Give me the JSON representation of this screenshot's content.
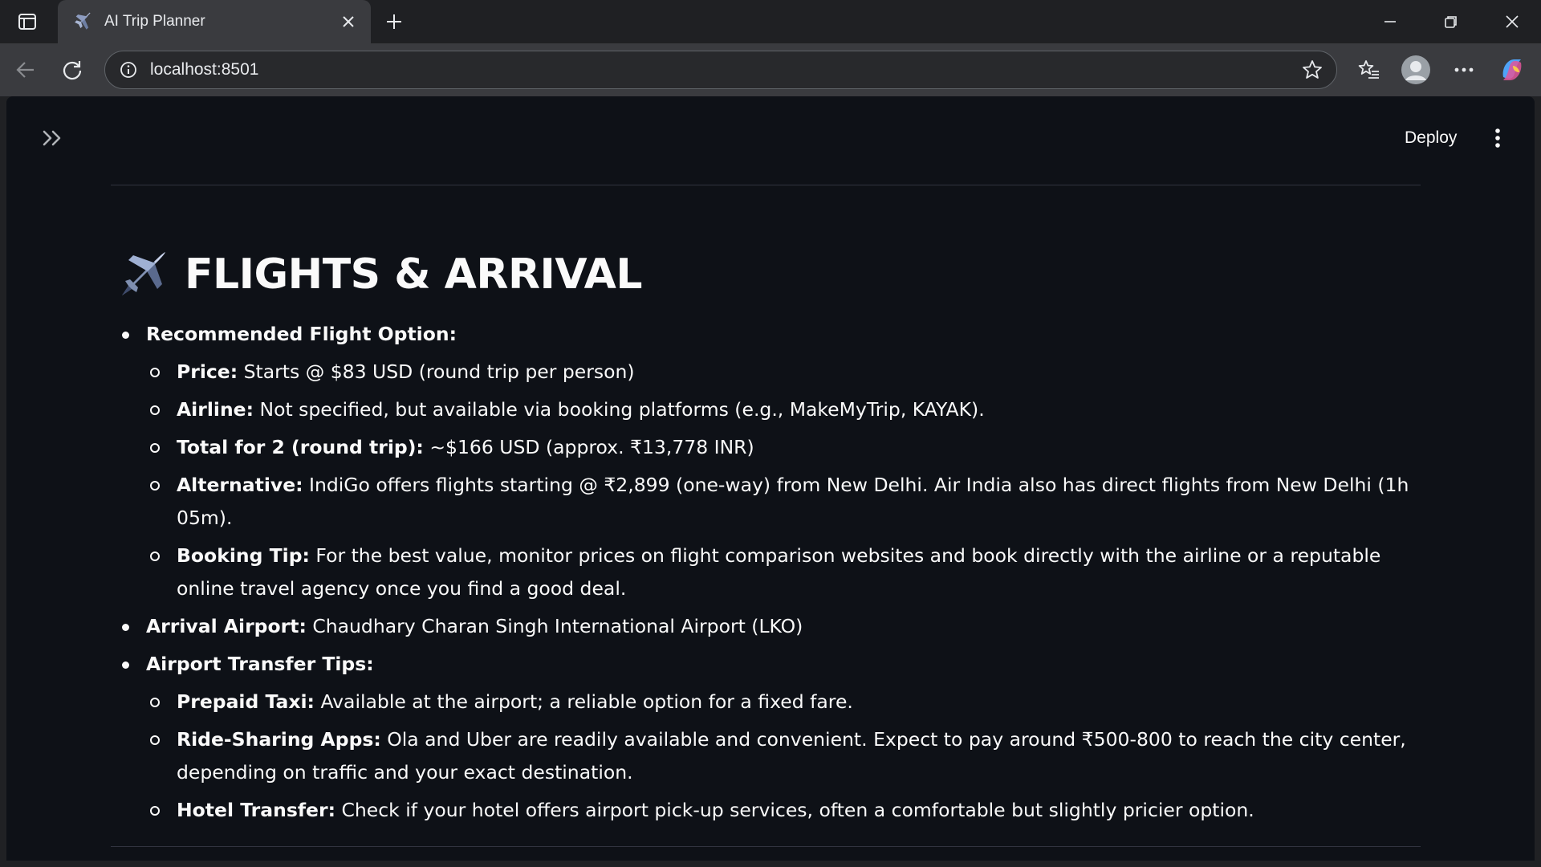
{
  "browser": {
    "tab_title": "AI Trip Planner",
    "url": "localhost:8501"
  },
  "app": {
    "deploy_label": "Deploy"
  },
  "section": {
    "heading": "FLIGHTS & ARRIVAL",
    "items": [
      {
        "label": "Recommended Flight Option:",
        "text": "",
        "sub": [
          {
            "label": "Price:",
            "text": " Starts @ $83 USD (round trip per person)"
          },
          {
            "label": "Airline:",
            "text": " Not specified, but available via booking platforms (e.g., MakeMyTrip, KAYAK)."
          },
          {
            "label": "Total for 2 (round trip):",
            "text": " ~$166 USD (approx. ₹13,778 INR)"
          },
          {
            "label": "Alternative:",
            "text": " IndiGo offers flights starting @ ₹2,899 (one-way) from New Delhi. Air India also has direct flights from New Delhi (1h 05m)."
          },
          {
            "label": "Booking Tip:",
            "text": " For the best value, monitor prices on flight comparison websites and book directly with the airline or a reputable online travel agency once you find a good deal."
          }
        ]
      },
      {
        "label": "Arrival Airport:",
        "text": " Chaudhary Charan Singh International Airport (LKO)",
        "sub": []
      },
      {
        "label": "Airport Transfer Tips:",
        "text": "",
        "sub": [
          {
            "label": "Prepaid Taxi:",
            "text": " Available at the airport; a reliable option for a fixed fare."
          },
          {
            "label": "Ride-Sharing Apps:",
            "text": " Ola and Uber are readily available and convenient. Expect to pay around ₹500-800 to reach the city center, depending on traffic and your exact destination."
          },
          {
            "label": "Hotel Transfer:",
            "text": " Check if your hotel offers airport pick-up services, often a comfortable but slightly pricier option."
          }
        ]
      }
    ]
  }
}
